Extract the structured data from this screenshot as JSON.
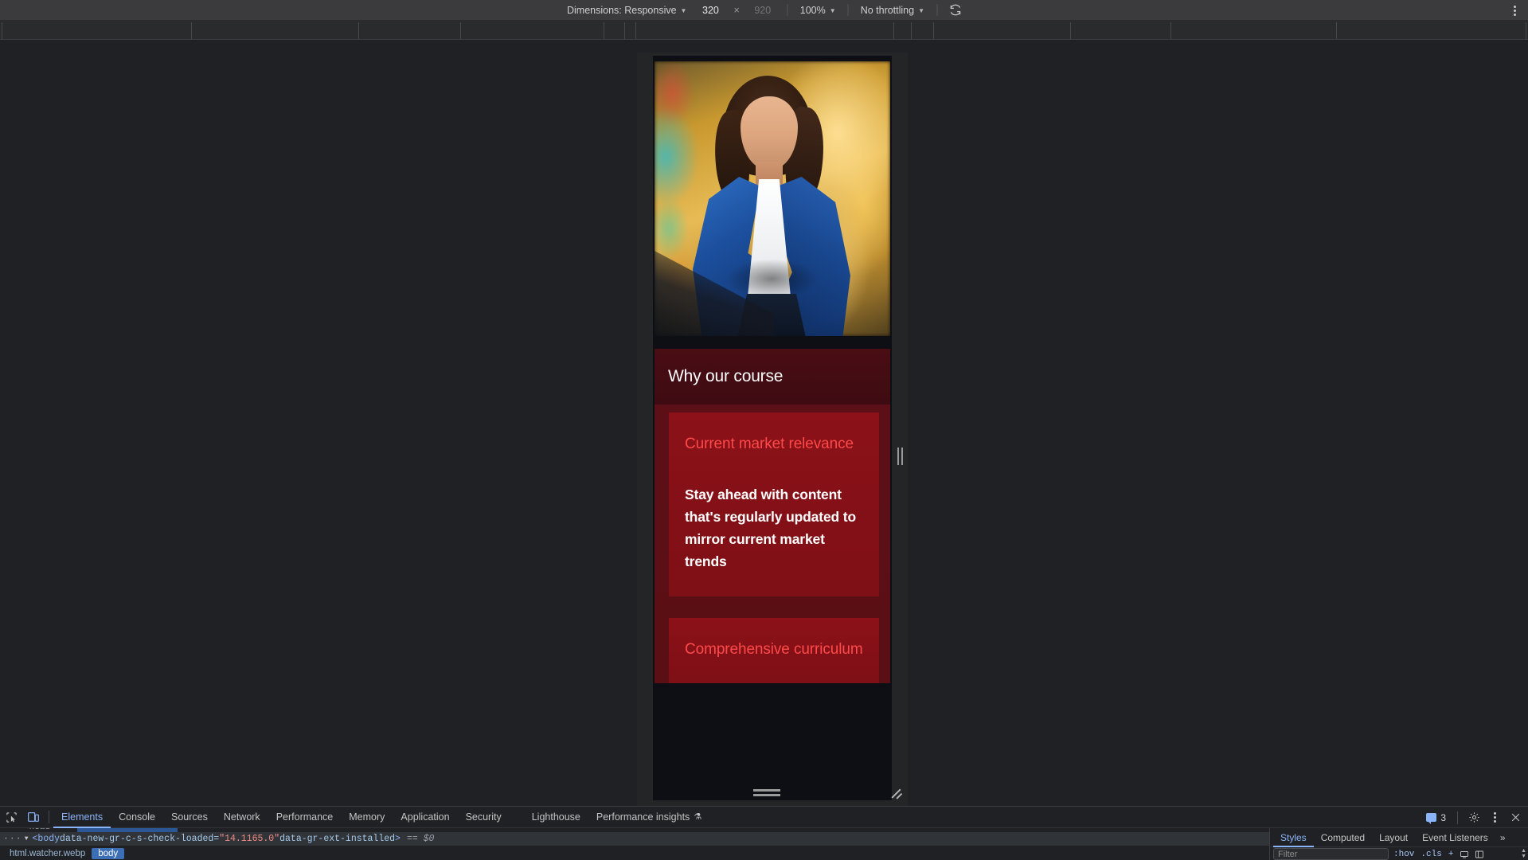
{
  "device_toolbar": {
    "dimensions_label": "Dimensions: Responsive",
    "width_value": "320",
    "height_placeholder": "920",
    "zoom_label": "100%",
    "throttling_label": "No throttling",
    "rotate_icon": "rotate-icon",
    "more_options_icon": "kebab-menu-icon"
  },
  "page": {
    "hero_image_alt": "smiling businesswoman in blue suit",
    "section_title": "Why our course",
    "cards": [
      {
        "heading": "Current market relevance",
        "body": "Stay ahead with content that's regularly updated to mirror current market trends"
      },
      {
        "heading": "Comprehensive curriculum",
        "body": ""
      }
    ]
  },
  "devtools": {
    "tabs": [
      {
        "label": "Elements",
        "active": true
      },
      {
        "label": "Console",
        "active": false
      },
      {
        "label": "Sources",
        "active": false
      },
      {
        "label": "Network",
        "active": false
      },
      {
        "label": "Performance",
        "active": false
      },
      {
        "label": "Memory",
        "active": false
      },
      {
        "label": "Application",
        "active": false
      },
      {
        "label": "Security",
        "active": false
      },
      {
        "label": "Lighthouse",
        "active": false
      },
      {
        "label": "Performance insights",
        "active": false
      }
    ],
    "issues_count": "3",
    "dom": {
      "ellipsis": "···",
      "arrow": "▼",
      "tag_open": "<body",
      "attr1_name": " data-new-gr-c-s-check-loaded=",
      "attr1_value": "\"14.1165.0\"",
      "attr2_name": " data-gr-ext-installed",
      "tag_close": ">",
      "selected_marker": "== $0"
    },
    "breadcrumbs": [
      {
        "label": "html.watcher.webp",
        "active": false
      },
      {
        "label": "body",
        "active": true
      }
    ],
    "styles_tabs": [
      {
        "label": "Styles",
        "active": true
      },
      {
        "label": "Computed",
        "active": false
      },
      {
        "label": "Layout",
        "active": false
      },
      {
        "label": "Event Listeners",
        "active": false
      }
    ],
    "styles_more": "»",
    "filter_placeholder": "Filter",
    "hov_label": ":hov",
    "cls_label": ".cls",
    "new_rule_label": "+"
  },
  "colors": {
    "accent_blue": "#8ab4f8",
    "brand_red": "#8c1118",
    "heading_red": "#ff4a4a",
    "chrome_bg": "#202124"
  }
}
